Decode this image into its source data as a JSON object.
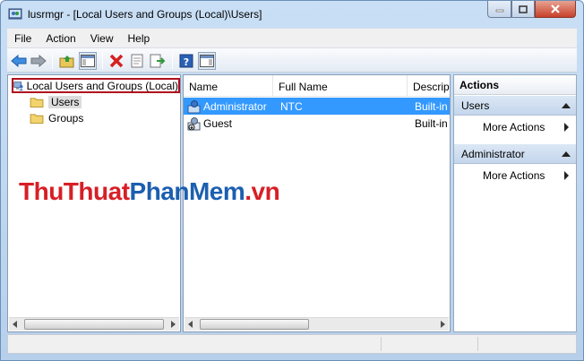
{
  "window": {
    "title": "lusrmgr - [Local Users and Groups (Local)\\Users]"
  },
  "menu": [
    "File",
    "Action",
    "View",
    "Help"
  ],
  "tree": {
    "root": "Local Users and Groups (Local)",
    "items": [
      {
        "label": "Users",
        "selected": true
      },
      {
        "label": "Groups",
        "selected": false
      }
    ]
  },
  "list": {
    "columns": [
      "Name",
      "Full Name",
      "Descript"
    ],
    "rows": [
      {
        "name": "Administrator",
        "full_name": "NTC",
        "description": "Built-in",
        "selected": true
      },
      {
        "name": "Guest",
        "full_name": "",
        "description": "Built-in",
        "selected": false
      }
    ]
  },
  "actions": {
    "title": "Actions",
    "groups": [
      {
        "label": "Users",
        "item": "More Actions"
      },
      {
        "label": "Administrator",
        "item": "More Actions"
      }
    ]
  },
  "watermark": {
    "part1": "ThuThuat",
    "part2": "PhanMem",
    "part3": ".vn"
  },
  "colors": {
    "selection": "#3399ff",
    "highlight_border": "#b00f1e",
    "watermark_red": "#d71f26",
    "watermark_blue": "#1c5fb0"
  }
}
